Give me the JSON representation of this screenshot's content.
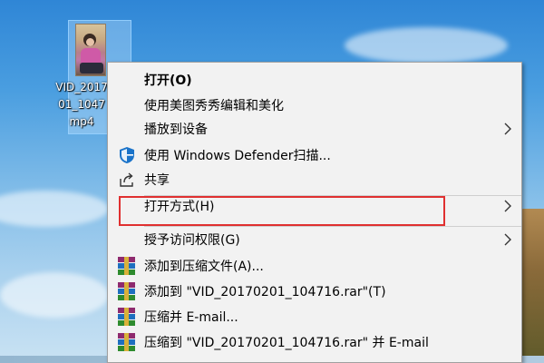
{
  "file": {
    "name": "VID_20170201_104716.mp4",
    "label_lines": [
      "VID_2017",
      "01_1047",
      "mp4"
    ],
    "thumbnail": "video-thumbnail-girl-pink"
  },
  "menu": {
    "items": [
      {
        "label": "打开(O)",
        "bold": true,
        "icon": null,
        "submenu": false
      },
      {
        "label": "使用美图秀秀编辑和美化",
        "icon": null,
        "submenu": false
      },
      {
        "label": "播放到设备",
        "icon": null,
        "submenu": true
      },
      {
        "label": "使用 Windows Defender扫描...",
        "icon": "windows-defender-shield-icon",
        "submenu": false
      },
      {
        "label": "共享",
        "icon": "share-icon",
        "submenu": false
      },
      {
        "label": "打开方式(H)",
        "icon": null,
        "submenu": true,
        "highlighted": true
      },
      {
        "label": "授予访问权限(G)",
        "icon": null,
        "submenu": true
      },
      {
        "label": "添加到压缩文件(A)...",
        "icon": "winrar-icon",
        "submenu": false
      },
      {
        "label": "添加到 \"VID_20170201_104716.rar\"(T)",
        "icon": "winrar-icon",
        "submenu": false
      },
      {
        "label": "压缩并 E-mail...",
        "icon": "winrar-icon",
        "submenu": false
      },
      {
        "label": "压缩到 \"VID_20170201_104716.rar\" 并 E-mail",
        "icon": "winrar-icon",
        "submenu": false
      }
    ]
  },
  "colors": {
    "menu_bg": "#f2f2f2",
    "highlight_border": "#e03030",
    "defender_blue": "#1a73c9"
  }
}
